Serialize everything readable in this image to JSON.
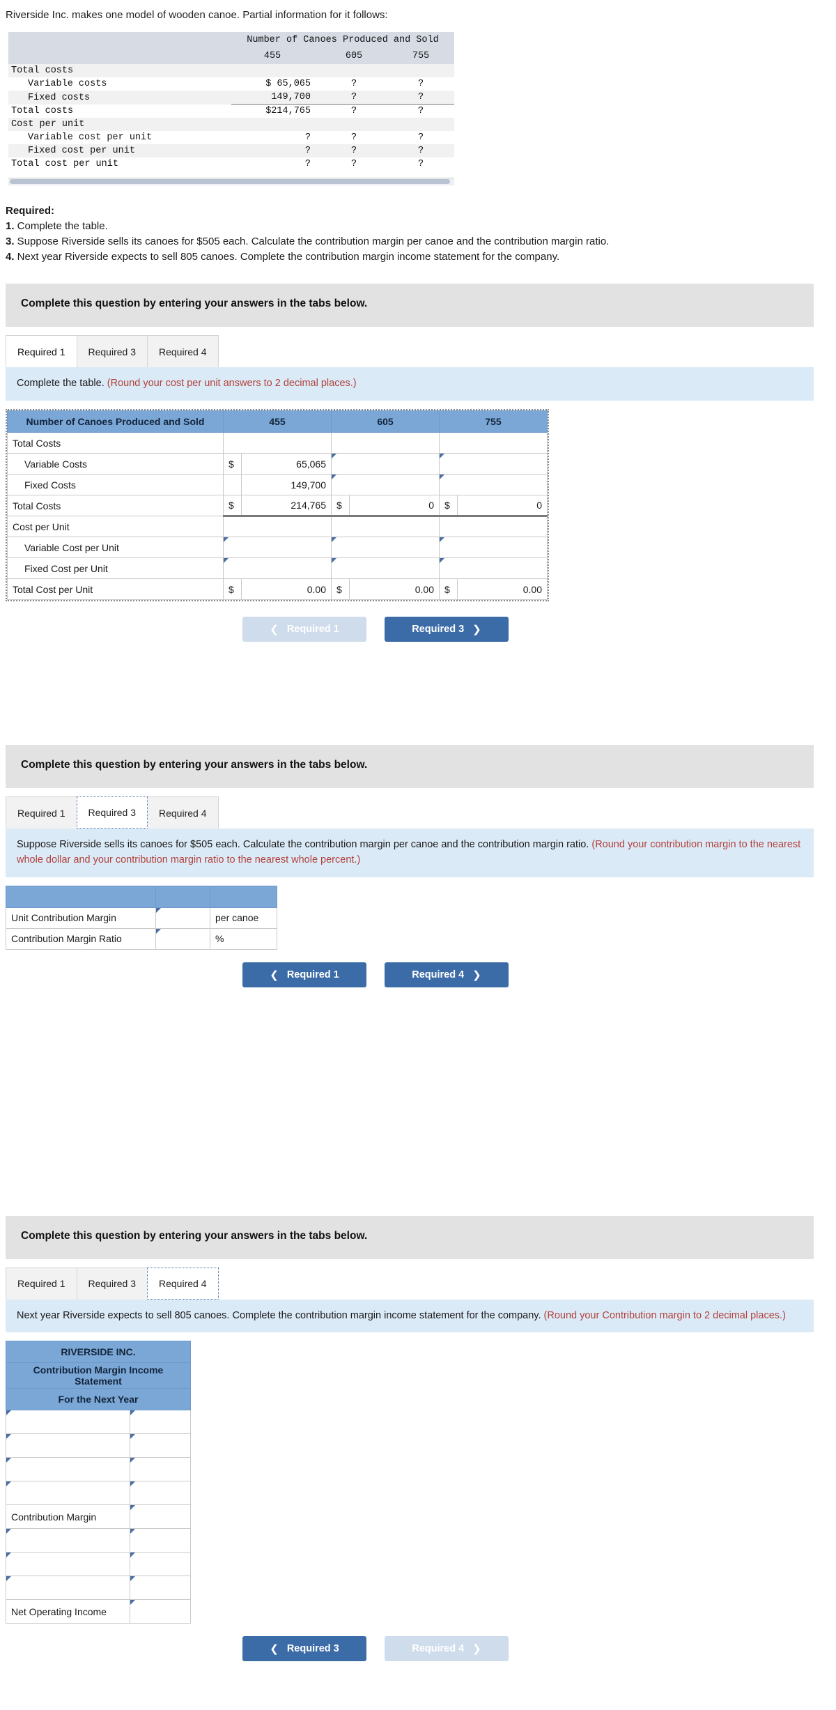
{
  "intro": "Riverside Inc. makes one model of wooden canoe. Partial information for it follows:",
  "problem_table": {
    "header_span": "Number of Canoes Produced and Sold",
    "columns": [
      "455",
      "605",
      "755"
    ],
    "rows": [
      {
        "label": "Total costs",
        "indent": 0,
        "c1": "",
        "c2": "",
        "c3": "",
        "shade": true
      },
      {
        "label": "Variable costs",
        "indent": 1,
        "c1": "$ 65,065",
        "c2": "?",
        "c3": "?",
        "shade": false
      },
      {
        "label": "Fixed costs",
        "indent": 1,
        "c1": "149,700",
        "c2": "?",
        "c3": "?",
        "shade": true,
        "underline": true
      },
      {
        "label": "Total costs",
        "indent": 0,
        "c1": "$214,765",
        "c2": "?",
        "c3": "?",
        "shade": false
      },
      {
        "label": "Cost per unit",
        "indent": 0,
        "c1": "",
        "c2": "",
        "c3": "",
        "shade": true
      },
      {
        "label": "Variable cost per unit",
        "indent": 1,
        "c1": "?",
        "c2": "?",
        "c3": "?",
        "shade": false
      },
      {
        "label": "Fixed cost per unit",
        "indent": 1,
        "c1": "?",
        "c2": "?",
        "c3": "?",
        "shade": true
      },
      {
        "label": "Total cost per unit",
        "indent": 0,
        "c1": "?",
        "c2": "?",
        "c3": "?",
        "shade": false
      }
    ]
  },
  "required": {
    "title": "Required:",
    "items": [
      {
        "num": "1.",
        "text": " Complete the table."
      },
      {
        "num": "3.",
        "text": " Suppose Riverside sells its canoes for $505 each. Calculate the contribution margin per canoe and the contribution margin ratio."
      },
      {
        "num": "4.",
        "text": " Next year Riverside expects to sell 805 canoes. Complete the contribution margin income statement for the company."
      }
    ]
  },
  "panel_heading": "Complete this question by entering your answers in the tabs below.",
  "tabs": [
    "Required 1",
    "Required 3",
    "Required 4"
  ],
  "req1": {
    "notice_main": "Complete the table. ",
    "notice_hint": "(Round your cost per unit answers to 2 decimal places.)",
    "table": {
      "header_label": "Number of Canoes Produced and Sold",
      "columns": [
        "455",
        "605",
        "755"
      ],
      "rows": [
        {
          "label": "Total Costs",
          "indent": 0,
          "type": "blank"
        },
        {
          "label": "Variable Costs",
          "indent": 1,
          "type": "mixed",
          "c1_cur": "$",
          "c1_val": "65,065",
          "c2": "",
          "c3": ""
        },
        {
          "label": "Fixed Costs",
          "indent": 1,
          "type": "mixed",
          "c1_cur": "",
          "c1_val": "149,700",
          "c2": "",
          "c3": ""
        },
        {
          "label": "Total Costs",
          "indent": 0,
          "type": "total",
          "c1_cur": "$",
          "c1_val": "214,765",
          "c2_cur": "$",
          "c2_val": "0",
          "c3_cur": "$",
          "c3_val": "0"
        },
        {
          "label": "Cost per Unit",
          "indent": 0,
          "type": "blank"
        },
        {
          "label": "Variable Cost per Unit",
          "indent": 1,
          "type": "inputs"
        },
        {
          "label": "Fixed Cost per Unit",
          "indent": 1,
          "type": "inputs"
        },
        {
          "label": "Total Cost per Unit",
          "indent": 0,
          "type": "total",
          "c1_cur": "$",
          "c1_val": "0.00",
          "c2_cur": "$",
          "c2_val": "0.00",
          "c3_cur": "$",
          "c3_val": "0.00"
        }
      ]
    },
    "btn_prev": "Required 1",
    "btn_next": "Required 3"
  },
  "req3": {
    "notice_main": "Suppose Riverside sells its canoes for $505 each. Calculate the contribution margin per canoe and the contribution margin ratio. ",
    "notice_hint": "(Round your contribution margin to the nearest whole dollar and your contribution margin ratio to the nearest whole percent.)",
    "rows": [
      {
        "label": "Unit Contribution Margin",
        "unit": "per canoe"
      },
      {
        "label": "Contribution Margin Ratio",
        "unit": "%"
      }
    ],
    "btn_prev": "Required 1",
    "btn_next": "Required 4"
  },
  "req4": {
    "notice_main": "Next year Riverside expects to sell 805 canoes. Complete the contribution margin income statement for the company. ",
    "notice_hint": "(Round your Contribution margin to 2 decimal places.)",
    "title_lines": [
      "RIVERSIDE INC.",
      "Contribution Margin Income Statement",
      "For the Next Year"
    ],
    "rows": [
      {
        "label": "",
        "type": "input"
      },
      {
        "label": "",
        "type": "input"
      },
      {
        "label": "",
        "type": "input"
      },
      {
        "label": "",
        "type": "input"
      },
      {
        "label": "Contribution Margin",
        "type": "static-label"
      },
      {
        "label": "",
        "type": "input"
      },
      {
        "label": "",
        "type": "input"
      },
      {
        "label": "",
        "type": "input"
      },
      {
        "label": "Net Operating Income",
        "type": "static-label"
      }
    ],
    "btn_prev": "Required 3",
    "btn_next": "Required 4"
  },
  "colors": {
    "table_header_blue": "#7ba7d7",
    "notice_blue": "#dbeaf7",
    "panel_grey": "#e2e2e2",
    "button_blue": "#3c6ca8",
    "button_disabled": "#cfdcec",
    "hint_red": "#b2413a"
  }
}
